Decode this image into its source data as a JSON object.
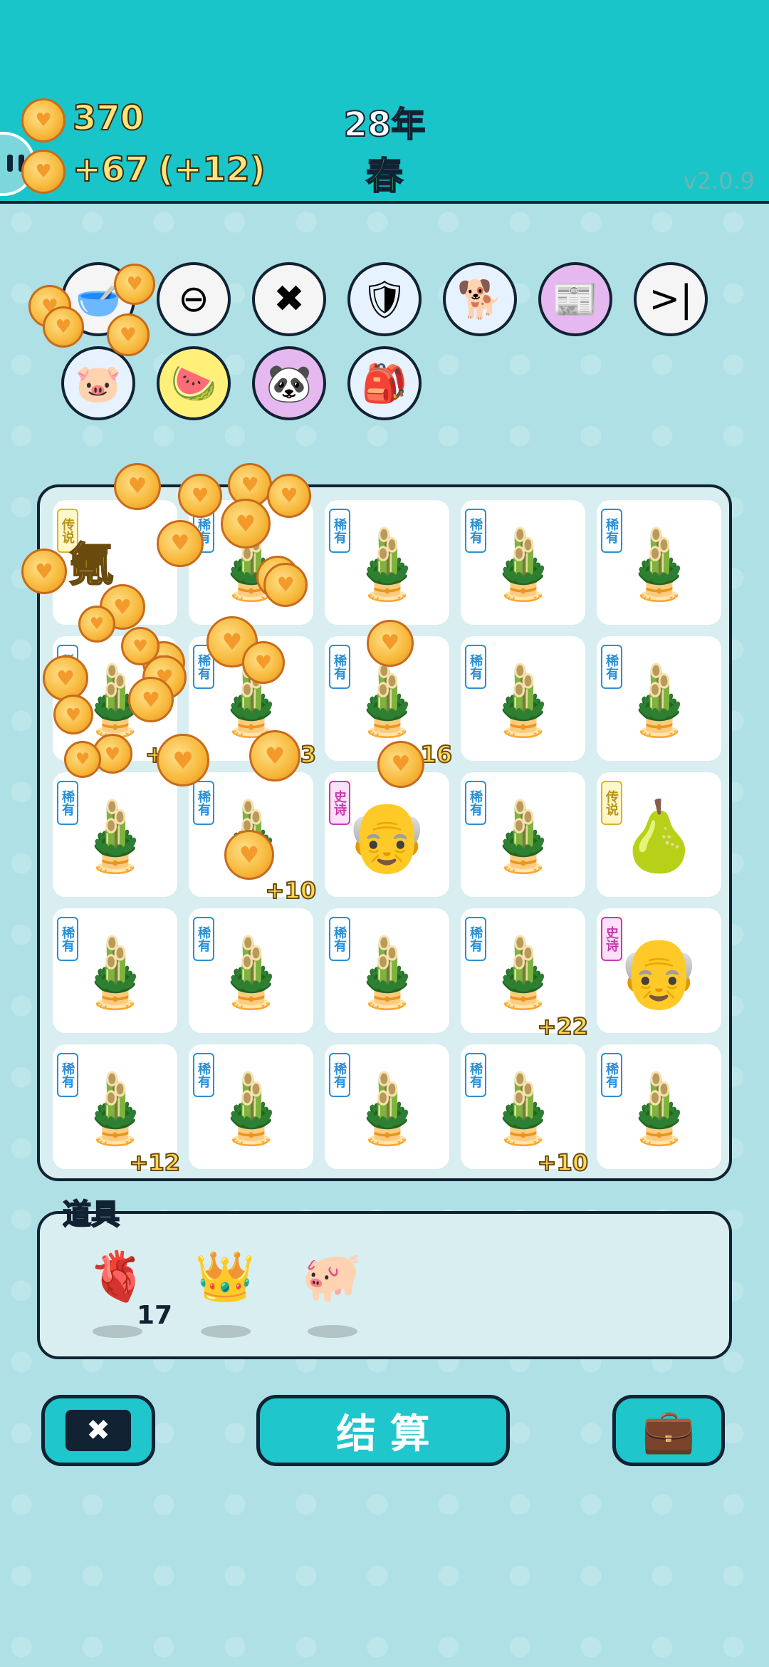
{
  "header": {
    "coins": "370",
    "income": "+67",
    "income_extra": "(+12)",
    "year": "28年",
    "season": "春",
    "version": "v2.0.9"
  },
  "items_row1": [
    {
      "name": "dog-food-bowl-icon",
      "bg": "#f5f5f5",
      "glyph": "🥣"
    },
    {
      "name": "remove-symbol-icon",
      "bg": "#f5f5f5",
      "glyph": "⊖"
    },
    {
      "name": "delete-tag-icon",
      "bg": "#f5f5f5",
      "glyph": "✖"
    },
    {
      "name": "shield-wrench-icon",
      "bg": "#e6f2ff",
      "glyph": "🛡"
    },
    {
      "name": "cool-dog-icon",
      "bg": "#e6f2ff",
      "glyph": "🐕"
    },
    {
      "name": "time-magazine-icon",
      "bg": "#e6b8f0",
      "glyph": "📰"
    },
    {
      "name": "skip-icon",
      "bg": "#f5f5f5",
      "glyph": ">|"
    }
  ],
  "items_row2": [
    {
      "name": "piggy-bank-icon",
      "bg": "#e6f2ff",
      "glyph": "🐷"
    },
    {
      "name": "fruit-basket-icon",
      "bg": "#fff079",
      "glyph": "🍉"
    },
    {
      "name": "panda-icon",
      "bg": "#e6b8f0",
      "glyph": "🐼"
    },
    {
      "name": "sack-icon",
      "bg": "#e6f2ff",
      "glyph": "🎒"
    }
  ],
  "grid": {
    "rows": [
      [
        {
          "tag": "传说",
          "tagtype": "leg",
          "symbol": "big",
          "big": "氪",
          "bonus": ""
        },
        {
          "tag": "稀有",
          "tagtype": "rare",
          "symbol": "🎍",
          "bonus": ""
        },
        {
          "tag": "稀有",
          "tagtype": "rare",
          "symbol": "🎍",
          "bonus": ""
        },
        {
          "tag": "稀有",
          "tagtype": "rare",
          "symbol": "🎍",
          "bonus": ""
        },
        {
          "tag": "稀有",
          "tagtype": "rare",
          "symbol": "🎍",
          "bonus": ""
        }
      ],
      [
        {
          "tag": "稀有",
          "tagtype": "rare",
          "symbol": "🎍",
          "bonus": "+1"
        },
        {
          "tag": "稀有",
          "tagtype": "rare",
          "symbol": "🎍",
          "bonus": "3"
        },
        {
          "tag": "稀有",
          "tagtype": "rare",
          "symbol": "🎍",
          "bonus": "16"
        },
        {
          "tag": "稀有",
          "tagtype": "rare",
          "symbol": "🎍",
          "bonus": ""
        },
        {
          "tag": "稀有",
          "tagtype": "rare",
          "symbol": "🎍",
          "bonus": ""
        }
      ],
      [
        {
          "tag": "稀有",
          "tagtype": "rare",
          "symbol": "🎍",
          "bonus": ""
        },
        {
          "tag": "稀有",
          "tagtype": "rare",
          "symbol": "🎍",
          "bonus": "+10"
        },
        {
          "tag": "史诗",
          "tagtype": "epic",
          "symbol": "👴",
          "bonus": ""
        },
        {
          "tag": "稀有",
          "tagtype": "rare",
          "symbol": "🎍",
          "bonus": ""
        },
        {
          "tag": "传说",
          "tagtype": "leg",
          "symbol": "🍐",
          "bonus": ""
        }
      ],
      [
        {
          "tag": "稀有",
          "tagtype": "rare",
          "symbol": "🎍",
          "bonus": ""
        },
        {
          "tag": "稀有",
          "tagtype": "rare",
          "symbol": "🎍",
          "bonus": ""
        },
        {
          "tag": "稀有",
          "tagtype": "rare",
          "symbol": "🎍",
          "bonus": ""
        },
        {
          "tag": "稀有",
          "tagtype": "rare",
          "symbol": "🎍",
          "bonus": "+22"
        },
        {
          "tag": "史诗",
          "tagtype": "epic",
          "symbol": "👴",
          "bonus": ""
        }
      ],
      [
        {
          "tag": "稀有",
          "tagtype": "rare",
          "symbol": "🎍",
          "bonus": "+12"
        },
        {
          "tag": "稀有",
          "tagtype": "rare",
          "symbol": "🎍",
          "bonus": ""
        },
        {
          "tag": "稀有",
          "tagtype": "rare",
          "symbol": "🎍",
          "bonus": ""
        },
        {
          "tag": "稀有",
          "tagtype": "rare",
          "symbol": "🎍",
          "bonus": "+10"
        },
        {
          "tag": "稀有",
          "tagtype": "rare",
          "symbol": "🎍",
          "bonus": ""
        }
      ]
    ]
  },
  "tools": {
    "title": "道具",
    "liver_count": "17",
    "liver_icon": "liver-icon",
    "crown_icon": "crown-icon",
    "piggy_icon": "piggy-bank-icon"
  },
  "buttons": {
    "remove_glyph": "✖",
    "settle_label": "结 算",
    "bag_glyph": "💼"
  }
}
